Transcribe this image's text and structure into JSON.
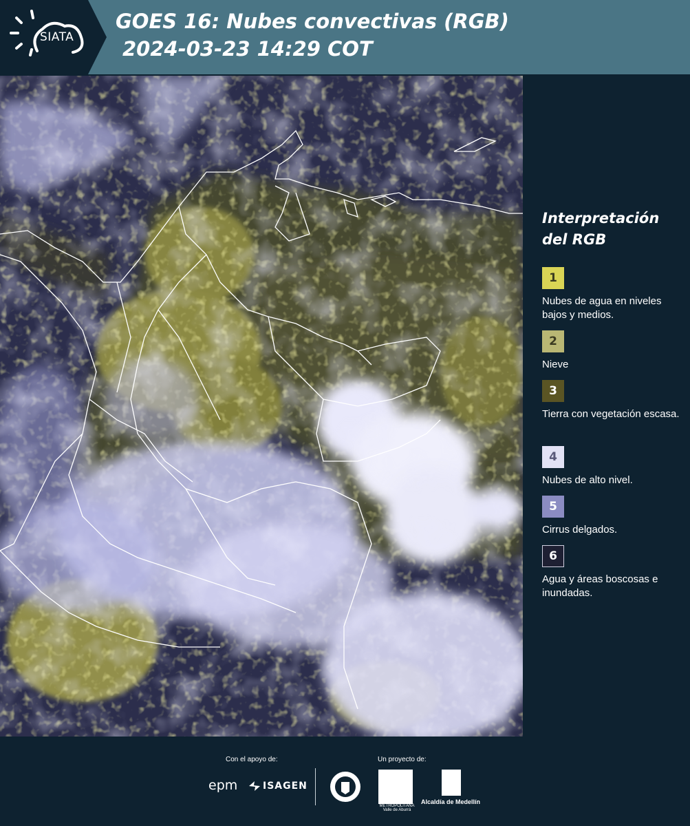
{
  "header": {
    "logo_text": "SIATA",
    "title_line1": "GOES 16: Nubes convectivas (RGB)",
    "title_line2": "2024-03-23 14:29 COT"
  },
  "map": {
    "description_icon": "satellite-rgb-image",
    "border_color": "#ffffff"
  },
  "legend": {
    "title": "Interpretación del RGB",
    "items": [
      {
        "number": "1",
        "label": "Nubes de agua en niveles bajos y medios.",
        "color": "#d9d455",
        "text_color": "#3a3a20"
      },
      {
        "number": "2",
        "label": "Nieve",
        "color": "#b9b774",
        "text_color": "#3a3a20"
      },
      {
        "number": "3",
        "label": "Tierra con vegetación escasa.",
        "color": "#5a5524",
        "text_color": "#ffffff"
      },
      {
        "number": "4",
        "label": "Nubes de alto nivel.",
        "color": "#e2e2f5",
        "text_color": "#5a5a7a"
      },
      {
        "number": "5",
        "label": "Cirrus delgados.",
        "color": "#8b8cc2",
        "text_color": "#ffffff"
      },
      {
        "number": "6",
        "label": "Agua y áreas boscosas e inundadas.",
        "color": "#1e2033",
        "text_color": "#ffffff"
      }
    ]
  },
  "footer": {
    "support_label": "Con el apoyo de:",
    "project_label": "Un proyecto de:",
    "epm": "epm",
    "isagen": "ISAGEN",
    "area_metropolitana": "METROPOLITANA Valle de Aburrá",
    "alcaldia": "Alcaldía de Medellín"
  }
}
